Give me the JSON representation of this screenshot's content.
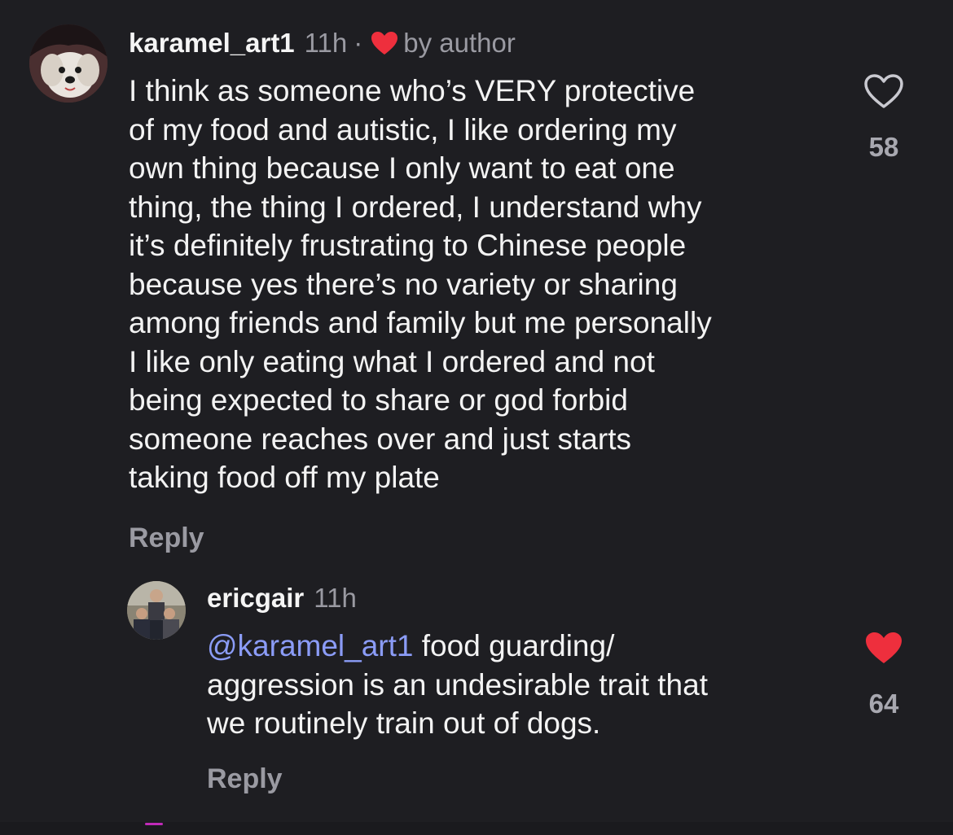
{
  "comments": [
    {
      "username": "karamel_art1",
      "time": "11h",
      "separator": "·",
      "author_badge": "by author",
      "lines": [
        "I think as someone who’s VERY protective",
        "of my food and autistic, I like ordering my",
        "own thing because I only want to eat one",
        "thing, the thing I ordered, I understand why",
        "it’s definitely frustrating to Chinese people",
        "because yes there’s no variety or sharing",
        "among friends and family but me personally",
        "I like only eating what I ordered and not",
        "being expected to share or god forbid",
        "someone reaches over and just starts",
        "taking food off my plate"
      ],
      "reply_label": "Reply",
      "likes": "58",
      "liked": false,
      "like_icon": "heart-outline-icon"
    },
    {
      "username": "ericgair",
      "time": "11h",
      "mention": "@karamel_art1",
      "lines": [
        " food guarding/",
        "aggression is an undesirable trait that",
        "we routinely train out of dogs."
      ],
      "reply_label": "Reply",
      "likes": "64",
      "liked": true,
      "like_icon": "heart-filled-icon"
    }
  ],
  "colors": {
    "background": "#1e1e22",
    "text": "#f3f3f3",
    "muted": "#9a9aa2",
    "mention": "#8b9cf7",
    "heart_red": "#ee2f3d"
  }
}
